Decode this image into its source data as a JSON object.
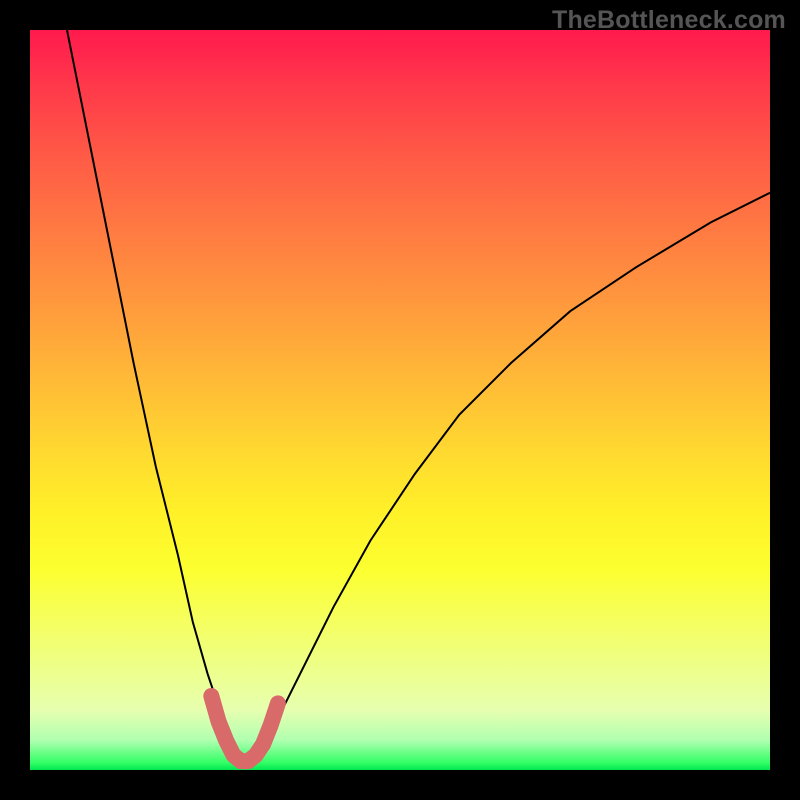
{
  "watermark": {
    "text": "TheBottleneck.com"
  },
  "chart_data": {
    "type": "line",
    "title": "",
    "xlabel": "",
    "ylabel": "",
    "xlim": [
      0,
      100
    ],
    "ylim": [
      0,
      100
    ],
    "grid": false,
    "legend": false,
    "series": [
      {
        "name": "bottleneck-curve",
        "x": [
          5,
          8,
          11,
          14,
          17,
          20,
          22,
          24,
          26,
          27.5,
          29,
          30.5,
          32,
          34,
          37,
          41,
          46,
          52,
          58,
          65,
          73,
          82,
          92,
          100
        ],
        "y": [
          100,
          85,
          70,
          55,
          41,
          29,
          20,
          13,
          7,
          3.5,
          1.5,
          2,
          4,
          8,
          14,
          22,
          31,
          40,
          48,
          55,
          62,
          68,
          74,
          78
        ]
      },
      {
        "name": "highlight-minimum",
        "x": [
          24.5,
          25.5,
          26.5,
          27.5,
          28.5,
          29.5,
          30.5,
          31.5,
          32.5,
          33.5
        ],
        "y": [
          10,
          6.5,
          4,
          2,
          1.2,
          1.2,
          2,
          3.5,
          6,
          9
        ]
      }
    ],
    "gradient_stops": [
      {
        "pos": 0.0,
        "color": "#ff1a4d"
      },
      {
        "pos": 0.5,
        "color": "#ffd930"
      },
      {
        "pos": 0.85,
        "color": "#fcff60"
      },
      {
        "pos": 1.0,
        "color": "#00e650"
      }
    ]
  }
}
